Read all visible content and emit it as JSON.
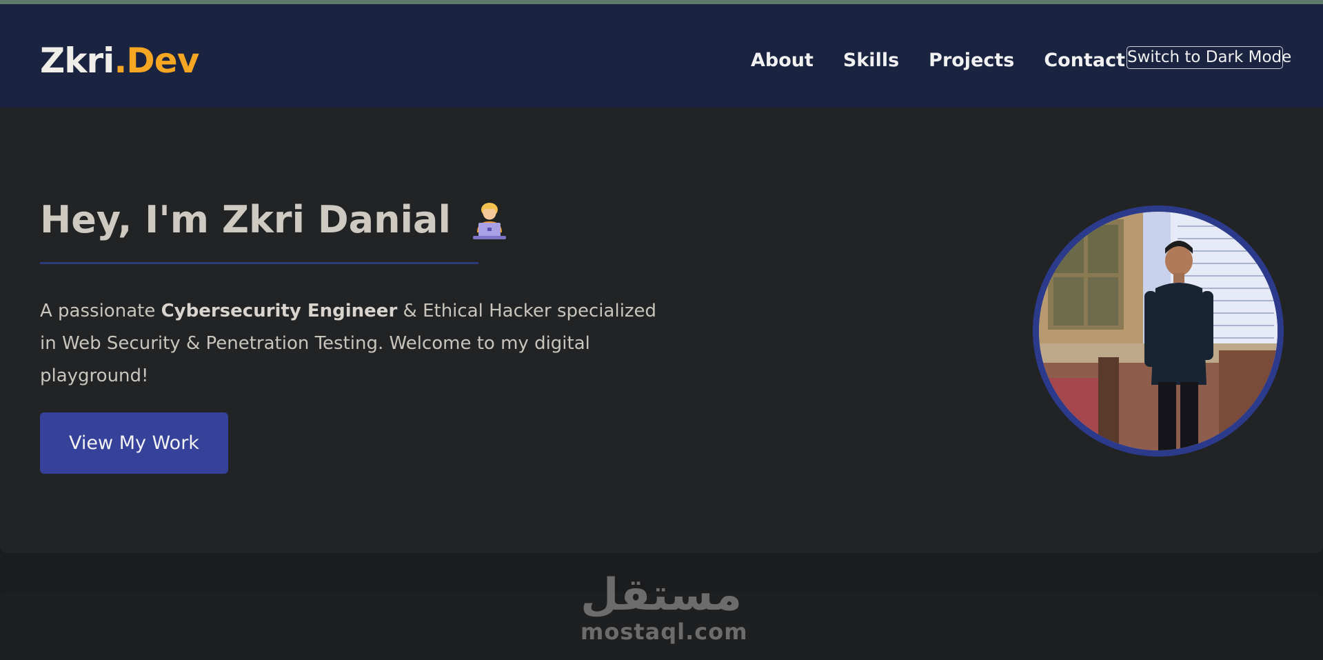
{
  "brand": {
    "name": "Zkri",
    "suffix": ".Dev",
    "accent_color": "#f5a623"
  },
  "nav": {
    "links": [
      "About",
      "Skills",
      "Projects",
      "Contact"
    ],
    "theme_toggle_label": "Switch to Dark Mode"
  },
  "hero": {
    "title": "Hey, I'm Zkri Danial",
    "title_emoji": "technologist-icon",
    "description": {
      "prefix": "A passionate ",
      "highlight": "Cybersecurity Engineer",
      "suffix": " & Ethical Hacker specialized in Web Security & Penetration Testing. Welcome to my digital playground!"
    },
    "cta_label": "View My Work",
    "cta_color": "#36429a",
    "avatar": "profile-photo"
  },
  "watermark": {
    "arabic": "مستقل",
    "latin": "mostaql.com"
  },
  "colors": {
    "navbar": "#1a2340",
    "hero_bg": "#222325",
    "underline": "#2e3b7c"
  }
}
